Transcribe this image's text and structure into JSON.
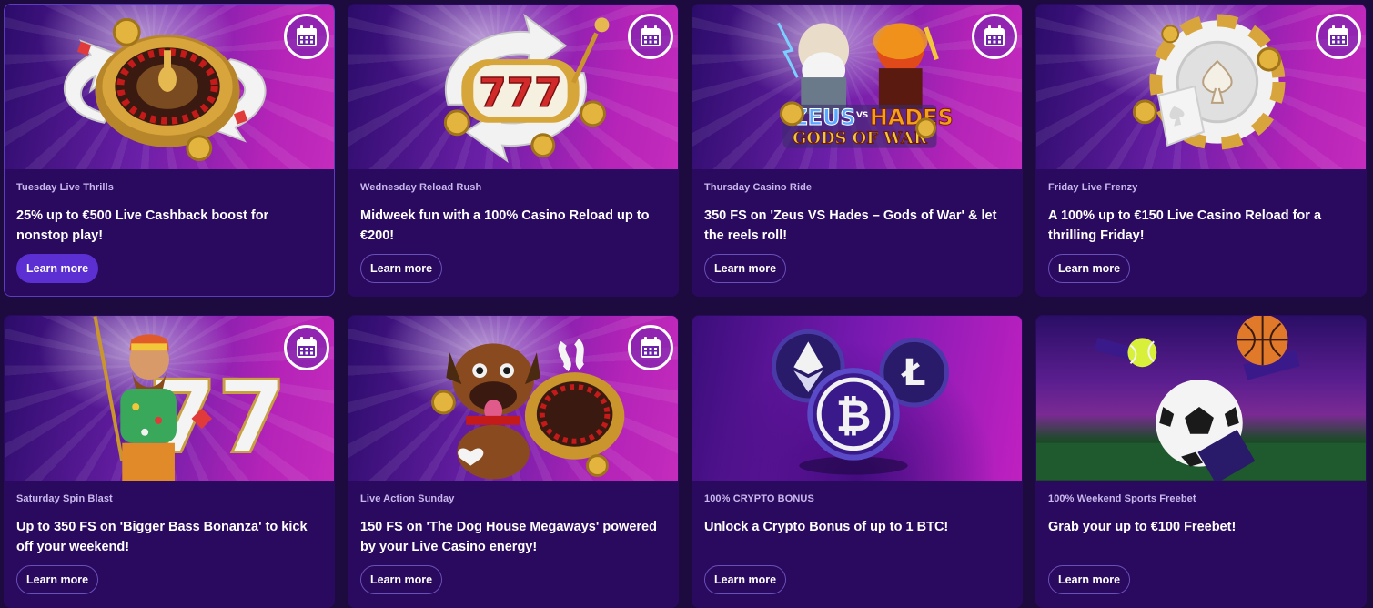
{
  "colors": {
    "page_bg": "#1d0a3e",
    "card_bg": "#2a0a5e",
    "accent_button": "#5b2fd1",
    "media_magenta": "#c42cbd"
  },
  "cards": [
    {
      "eyebrow": "Tuesday Live Thrills",
      "headline": "25% up to €500 Live Cashback boost for nonstop play!",
      "cta": "Learn more",
      "art": "roulette-wheel",
      "has_calendar": true,
      "calendar_icon": "calendar-icon"
    },
    {
      "eyebrow": "Wednesday Reload Rush",
      "headline": "Midweek fun with a 100% Casino Reload up to €200!",
      "cta": "Learn more",
      "art": "slot-777",
      "has_calendar": true,
      "calendar_icon": "calendar-icon"
    },
    {
      "eyebrow": "Thursday Casino Ride",
      "headline": "350 FS on 'Zeus VS Hades – Gods of War' & let the reels roll!",
      "cta": "Learn more",
      "art": "zeus-vs-hades",
      "art_logo": {
        "top_left": "ZEUS",
        "vs": "VS",
        "top_right": "HADES",
        "bottom": "GODS OF WAR"
      },
      "has_calendar": true,
      "calendar_icon": "calendar-icon"
    },
    {
      "eyebrow": "Friday Live Frenzy",
      "headline": "A 100% up to €150 Live Casino Reload for a thrilling Friday!",
      "cta": "Learn more",
      "art": "poker-chip",
      "has_calendar": true,
      "calendar_icon": "calendar-icon"
    },
    {
      "eyebrow": "Saturday Spin Blast",
      "headline": "Up to 350 FS on 'Bigger Bass Bonanza' to kick off your weekend!",
      "cta": "Learn more",
      "art": "fisherman-777",
      "has_calendar": true,
      "calendar_icon": "calendar-icon"
    },
    {
      "eyebrow": "Live Action Sunday",
      "headline": "150 FS on 'The Dog House Megaways' powered by your Live Casino energy!",
      "cta": "Learn more",
      "art": "dog-roulette",
      "has_calendar": true,
      "calendar_icon": "calendar-icon"
    },
    {
      "eyebrow": "100% CRYPTO BONUS",
      "headline": "Unlock a Crypto Bonus of up to 1 BTC!",
      "cta": "Learn more",
      "art": "crypto-coins",
      "has_calendar": false
    },
    {
      "eyebrow": "100% Weekend Sports Freebet",
      "headline": "Grab your up to €100 Freebet!",
      "cta": "Learn more",
      "art": "sports-balls",
      "has_calendar": false
    }
  ]
}
